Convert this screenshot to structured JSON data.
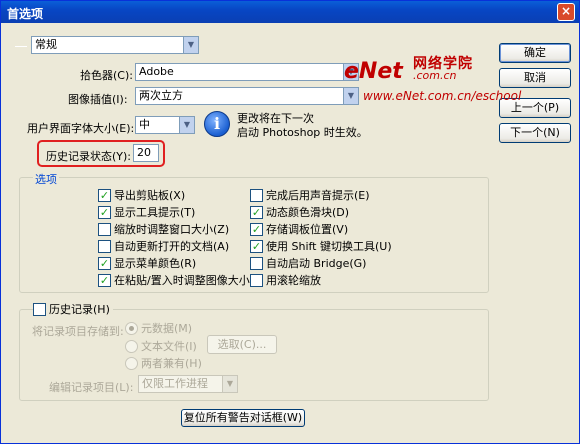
{
  "window": {
    "title": "首选项",
    "close_symbol": "×"
  },
  "panel_select": {
    "value": "常规"
  },
  "color_picker": {
    "label": "拾色器(C):",
    "value": "Adobe"
  },
  "interpolation": {
    "label": "图像插值(I):",
    "value": "两次立方"
  },
  "ui_font_size": {
    "label": "用户界面字体大小(E):",
    "value": "中"
  },
  "notice": {
    "line1": "更改将在下一次",
    "line2": "启动 Photoshop 时生效。"
  },
  "history_states": {
    "label": "历史记录状态(Y):",
    "value": "20"
  },
  "buttons": {
    "ok": "确定",
    "cancel": "取消",
    "prev": "上一个(P)",
    "next": "下一个(N)",
    "reset_warnings": "复位所有警告对话框(W)"
  },
  "options": {
    "legend": "选项",
    "left": [
      {
        "label": "导出剪贴板(X)",
        "checked": true
      },
      {
        "label": "显示工具提示(T)",
        "checked": true
      },
      {
        "label": "缩放时调整窗口大小(Z)",
        "checked": false
      },
      {
        "label": "自动更新打开的文档(A)",
        "checked": false
      },
      {
        "label": "显示菜单颜色(R)",
        "checked": true
      },
      {
        "label": "在粘贴/置入时调整图像大小",
        "checked": true
      }
    ],
    "right": [
      {
        "label": "完成后用声音提示(E)",
        "checked": false
      },
      {
        "label": "动态颜色滑块(D)",
        "checked": true
      },
      {
        "label": "存储调板位置(V)",
        "checked": true
      },
      {
        "label": "使用 Shift 键切换工具(U)",
        "checked": true
      },
      {
        "label": "自动启动 Bridge(G)",
        "checked": false
      },
      {
        "label": "用滚轮缩放",
        "checked": false
      }
    ]
  },
  "history_log": {
    "legend": "历史记录(H)",
    "save_to_label": "将记录项目存储到:",
    "radio_metadata": "元数据(M)",
    "radio_textfile": "文本文件(I)",
    "choose_button": "选取(C)...",
    "radio_both": "两者兼有(H)",
    "edit_log_label": "编辑记录项目(L):",
    "edit_log_value": "仅限工作进程"
  },
  "watermark": {
    "logo": "eNet",
    "cn": "网络学院",
    "domain": ".com.cn",
    "url": "www.eNet.com.cn/eschool"
  },
  "colors": {
    "title_bar": "#0846c4",
    "highlight": "#e02020",
    "watermark": "#c00000"
  }
}
